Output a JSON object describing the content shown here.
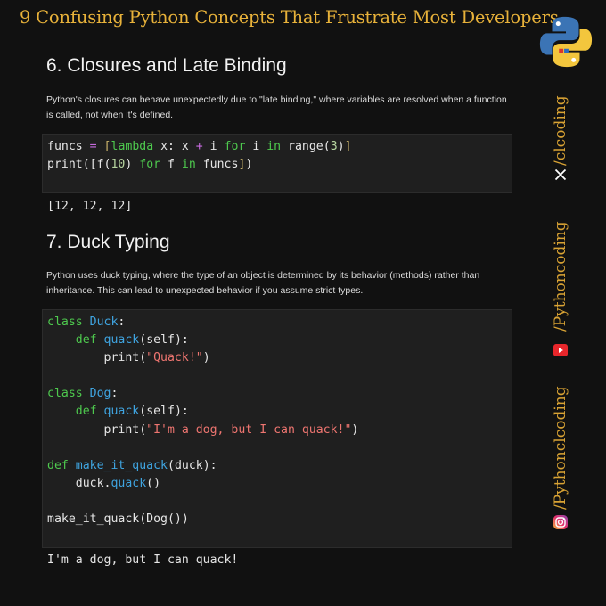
{
  "header": {
    "title": "9 Confusing Python Concepts That Frustrate Most Developers"
  },
  "colors": {
    "accent": "#e8b23a",
    "background": "#111111",
    "code_bg": "#1f1f1f"
  },
  "sections": [
    {
      "title": "6. Closures and Late Binding",
      "description": "Python's closures can behave unexpectedly due to \"late binding,\" where variables are resolved when a function is called, not when it's defined.",
      "code_lines": [
        "funcs = [lambda x: x + i for i in range(3)]",
        "print([f(10) for f in funcs])"
      ],
      "output": "[12, 12, 12]"
    },
    {
      "title": "7. Duck Typing",
      "description": "Python uses duck typing, where the type of an object is determined by its behavior (methods) rather than inheritance. This can lead to unexpected behavior if you assume strict types.",
      "code_lines": [
        "class Duck:",
        "    def quack(self):",
        "        print(\"Quack!\")",
        "",
        "class Dog:",
        "    def quack(self):",
        "        print(\"I'm a dog, but I can quack!\")",
        "",
        "def make_it_quack(duck):",
        "    duck.quack()",
        "",
        "make_it_quack(Dog())"
      ],
      "output": "I'm a dog, but I can quack!"
    }
  ],
  "sidebar": {
    "handles": [
      {
        "text": "/clcoding",
        "icon": "x-icon"
      },
      {
        "text": "/Pythoncoding",
        "icon": "youtube-icon"
      },
      {
        "text": "/Pythonclcoding",
        "icon": "instagram-icon"
      }
    ]
  },
  "logo": {
    "icon": "python-logo-icon"
  }
}
